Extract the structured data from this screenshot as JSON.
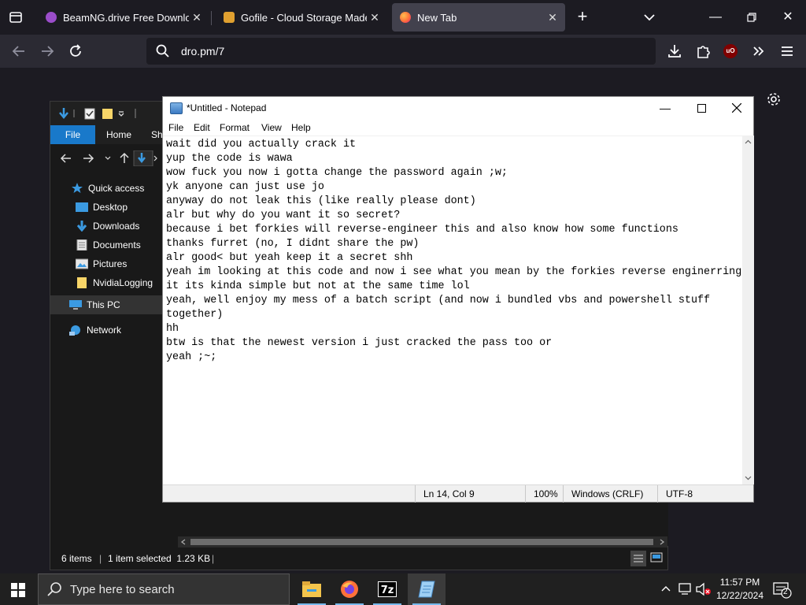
{
  "browser": {
    "tabs": [
      {
        "title": "BeamNG.drive Free Download (",
        "favicon_color": "#9b4dca",
        "active": false
      },
      {
        "title": "Gofile - Cloud Storage Made Si",
        "favicon_color": "#e0a030",
        "active": false
      },
      {
        "title": "New Tab",
        "favicon_color": "#ff7139",
        "active": true
      }
    ],
    "url": "dro.pm/7",
    "ublock_label": "uO"
  },
  "explorer": {
    "ribbon_tabs": [
      "File",
      "Home",
      "Sh"
    ],
    "sidebar": [
      {
        "label": "Quick access",
        "icon": "star-icon"
      },
      {
        "label": "Desktop",
        "icon": "desktop-icon"
      },
      {
        "label": "Downloads",
        "icon": "download-icon"
      },
      {
        "label": "Documents",
        "icon": "document-icon"
      },
      {
        "label": "Pictures",
        "icon": "pictures-icon"
      },
      {
        "label": "NvidiaLogging",
        "icon": "folder-icon"
      },
      {
        "label": "This PC",
        "icon": "pc-icon"
      },
      {
        "label": "Network",
        "icon": "network-icon"
      }
    ],
    "status": {
      "items": "6 items",
      "selected": "1 item selected  1.23 KB"
    }
  },
  "notepad": {
    "title": "*Untitled - Notepad",
    "menu": [
      "File",
      "Edit",
      "Format",
      "View",
      "Help"
    ],
    "lines": [
      "wait did you actually crack it",
      "yup the code is wawa",
      "wow fuck you now i gotta change the password again ;w;",
      "yk anyone can just use jo",
      "anyway do not leak this (like really please dont)",
      "alr but why do you want it so secret?",
      "because i bet forkies will reverse-engineer this and also know how some functions",
      "thanks furret (no, I didnt share the pw)",
      "alr good< but yeah keep it a secret shh",
      "yeah im looking at this code and now i see what you mean by the forkies reverse enginerring",
      "it its kinda simple but not at the same time lol",
      "yeah, well enjoy my mess of a batch script (and now i bundled vbs and powershell stuff",
      "together)",
      "hh",
      "btw is that the newest version i just cracked the pass too or",
      "yeah ;~;"
    ],
    "status": {
      "position": "Ln 14, Col 9",
      "zoom": "100%",
      "line_ending": "Windows (CRLF)",
      "encoding": "UTF-8"
    }
  },
  "taskbar": {
    "search_placeholder": "Type here to search",
    "apps": [
      "file-explorer-icon",
      "firefox-icon",
      "7zip-icon",
      "notepad-icon"
    ],
    "time": "11:57 PM",
    "date": "12/22/2024",
    "notification_count": "2"
  }
}
